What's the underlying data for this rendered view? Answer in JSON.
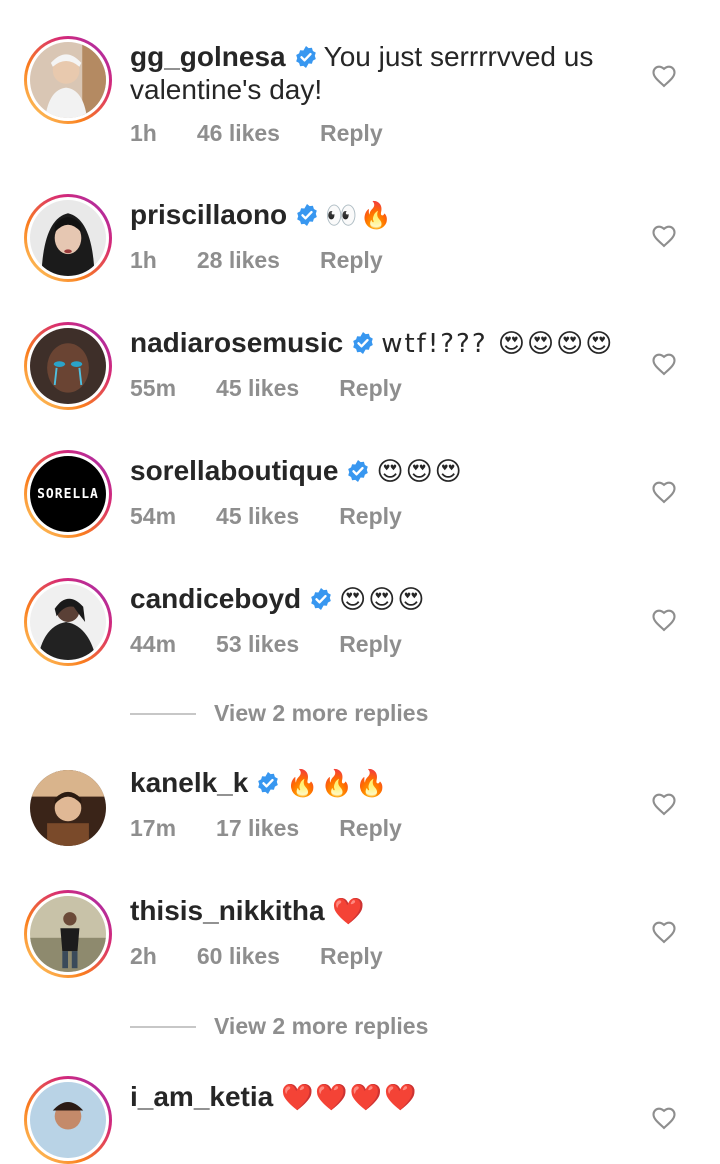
{
  "colors": {
    "text": "#262626",
    "muted": "#8e8e8e",
    "verified": "#3897f0",
    "story_ring_start": "#feda75",
    "story_ring_end": "#962fbf"
  },
  "comments": [
    {
      "username": "gg_golnesa",
      "verified": true,
      "text_line1": "You just serrrrvved us",
      "text_line2": "valentine's day!",
      "time": "1h",
      "likes": "46 likes",
      "reply": "Reply"
    },
    {
      "username": "priscillaono",
      "verified": true,
      "text": "👀🔥",
      "time": "1h",
      "likes": "28 likes",
      "reply": "Reply"
    },
    {
      "username": "nadiarosemusic",
      "verified": true,
      "text": "wtf!??? 😍😍😍😍",
      "time": "55m",
      "likes": "45 likes",
      "reply": "Reply"
    },
    {
      "username": "sorellaboutique",
      "verified": true,
      "avatar_text": "SORELLA",
      "text": "😍😍😍",
      "time": "54m",
      "likes": "45 likes",
      "reply": "Reply"
    },
    {
      "username": "candiceboyd",
      "verified": true,
      "text": "😍😍😍",
      "time": "44m",
      "likes": "53 likes",
      "reply": "Reply"
    },
    {
      "username": "kanelk_k",
      "verified": true,
      "text": "🔥🔥🔥",
      "time": "17m",
      "likes": "17 likes",
      "reply": "Reply"
    },
    {
      "username": "thisis_nikkitha",
      "verified": false,
      "text": "❤️",
      "time": "2h",
      "likes": "60 likes",
      "reply": "Reply"
    },
    {
      "username": "i_am_ketia",
      "verified": false,
      "text": "❤️❤️❤️❤️"
    }
  ],
  "more_replies": [
    "View 2 more replies",
    "View 2 more replies"
  ],
  "icons": {
    "like": "heart-outline-icon",
    "verified": "verified-badge-icon"
  }
}
